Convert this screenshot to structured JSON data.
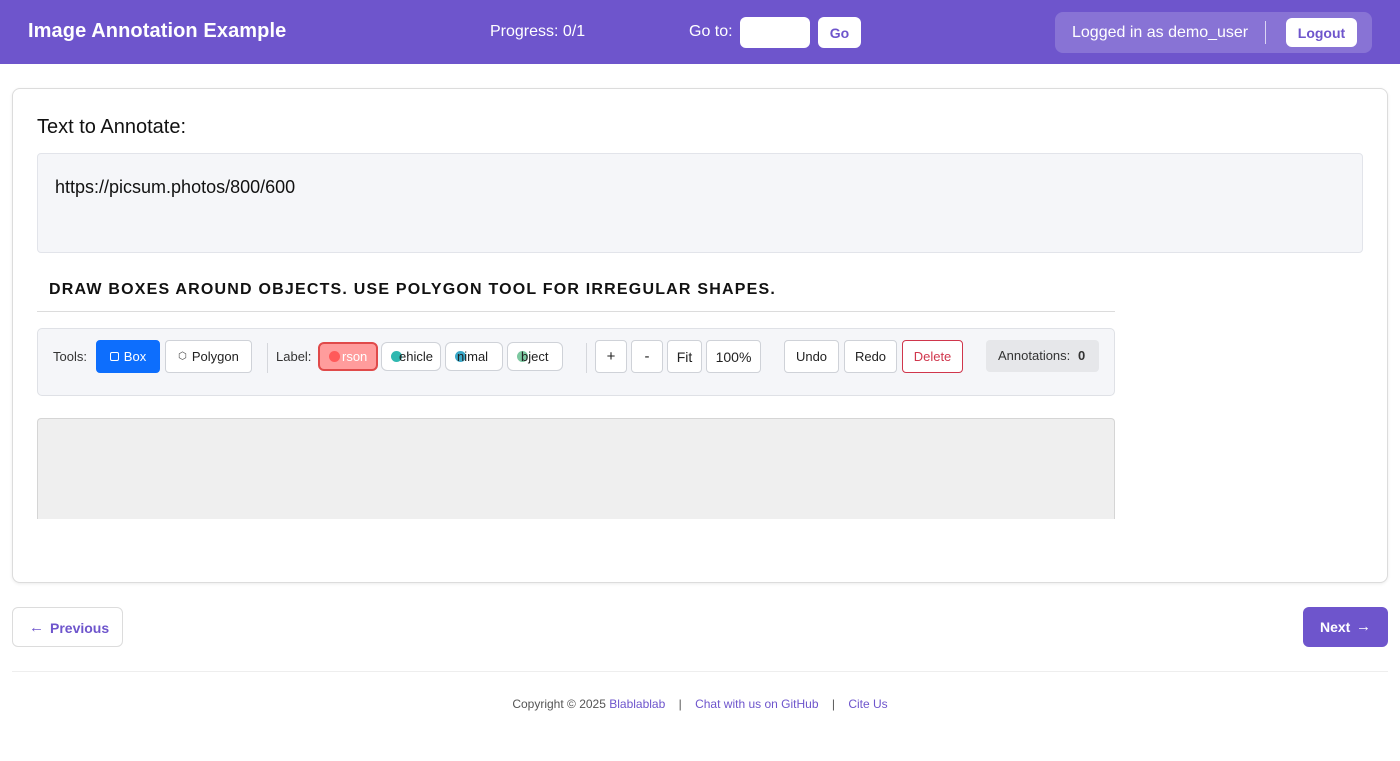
{
  "header": {
    "title": "Image Annotation Example",
    "progress": "Progress: 0/1",
    "goto_label": "Go to:",
    "goto_value": "",
    "goto_button": "Go",
    "user_text": "Logged in as demo_user",
    "logout_label": "Logout"
  },
  "main": {
    "section_title": "Text to Annotate:",
    "text_content": "https://picsum.photos/800/600",
    "instructions": "DRAW BOXES AROUND OBJECTS. USE POLYGON TOOL FOR IRREGULAR SHAPES."
  },
  "toolbar": {
    "tools_label": "Tools:",
    "box_label": "Box",
    "polygon_label": "Polygon",
    "label_label": "Label:",
    "labels": [
      {
        "name": "person",
        "visible_text": "rson",
        "color": "#ff5a5a"
      },
      {
        "name": "vehicle",
        "visible_text": "ehicle",
        "color": "#2fb8b0"
      },
      {
        "name": "animal",
        "visible_text": "nimal",
        "color": "#3aa8c8"
      },
      {
        "name": "object",
        "visible_text": "bject",
        "color": "#7cc8a0"
      }
    ],
    "zoom_in": "+",
    "zoom_out": "-",
    "fit": "Fit",
    "zoom_level": "100%",
    "undo": "Undo",
    "redo": "Redo",
    "delete": "Delete",
    "annotations_label": "Annotations:",
    "annotations_count": "0"
  },
  "nav": {
    "previous": "Previous",
    "next": "Next"
  },
  "footer": {
    "copyright": "Copyright © 2025",
    "brand_link": "Blablablab",
    "github_link": "Chat with us on GitHub",
    "cite_link": "Cite Us",
    "separator": "|"
  },
  "colors": {
    "brand": "#6e55cc",
    "active_tool": "#0d6efd",
    "delete": "#d0364c"
  }
}
